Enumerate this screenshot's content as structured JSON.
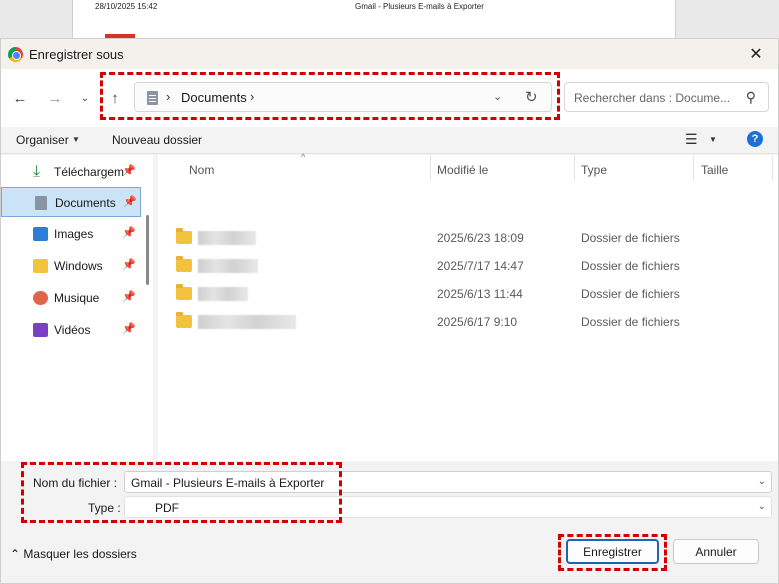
{
  "background_page": {
    "date": "28/10/2025 15:42",
    "title": "Gmail - Plusieurs E-mails à Exporter"
  },
  "dialog": {
    "title": "Enregistrer sous",
    "close_icon": "close-icon"
  },
  "nav": {
    "back_icon": "arrow-left-icon",
    "forward_icon": "arrow-right-icon",
    "recent_icon": "chevron-down-icon",
    "up_icon": "arrow-up-icon",
    "path": [
      "Documents"
    ],
    "search_placeholder": "Rechercher dans : Docume..."
  },
  "toolbar": {
    "organize_label": "Organiser",
    "new_folder_label": "Nouveau dossier",
    "view_icon": "list-view-icon",
    "help_icon": "?"
  },
  "sidebar": {
    "items": [
      {
        "label": "Téléchargem",
        "icon": "download-icon",
        "pinned": true,
        "selected": false
      },
      {
        "label": "Documents",
        "icon": "document-icon",
        "pinned": true,
        "selected": true
      },
      {
        "label": "Images",
        "icon": "image-icon",
        "pinned": true,
        "selected": false
      },
      {
        "label": "Windows",
        "icon": "folder-icon",
        "pinned": true,
        "selected": false
      },
      {
        "label": "Musique",
        "icon": "music-icon",
        "pinned": true,
        "selected": false
      },
      {
        "label": "Vidéos",
        "icon": "video-icon",
        "pinned": true,
        "selected": false
      }
    ]
  },
  "files": {
    "columns": [
      "Nom",
      "Modifié le",
      "Type",
      "Taille"
    ],
    "rows": [
      {
        "name": "",
        "modified": "2025/6/23 18:09",
        "type": "Dossier de fichiers"
      },
      {
        "name": "",
        "modified": "2025/7/17 14:47",
        "type": "Dossier de fichiers"
      },
      {
        "name": "",
        "modified": "2025/6/13 11:44",
        "type": "Dossier de fichiers"
      },
      {
        "name": "",
        "modified": "2025/6/17 9:10",
        "type": "Dossier de fichiers"
      }
    ]
  },
  "form": {
    "filename_label": "Nom du fichier :",
    "filename_value": "Gmail - Plusieurs E-mails à Exporter",
    "type_label": "Type :",
    "type_value": "PDF"
  },
  "footer": {
    "hide_folders_label": "Masquer les dossiers",
    "save_label": "Enregistrer",
    "cancel_label": "Annuler"
  },
  "colors": {
    "highlight": "#d40000",
    "selected_bg": "#cce4f7",
    "primary_border": "#2463b0"
  }
}
